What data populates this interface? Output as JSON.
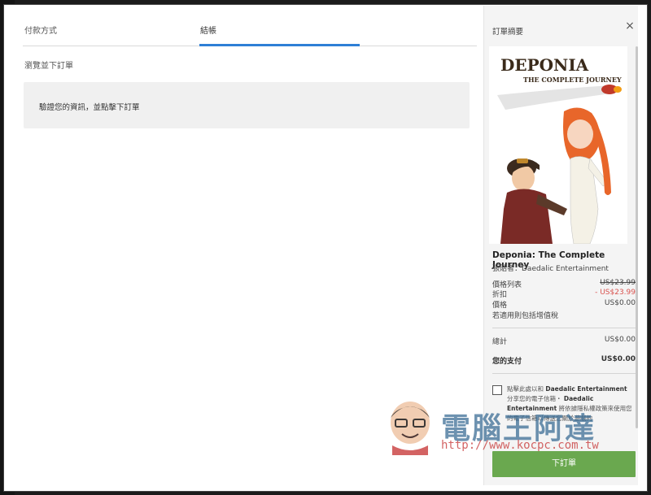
{
  "tabs": {
    "payment": "付款方式",
    "review": "結帳"
  },
  "main": {
    "section_title": "瀏覽並下訂單",
    "info_text": "驗證您的資訊，並點擊下訂單"
  },
  "sidebar": {
    "title": "訂單摘要",
    "close": "×",
    "cover_art": {
      "title_line1": "DEPONIA",
      "title_line2": "THE COMPLETE JOURNEY"
    },
    "product_name": "Deponia: The Complete Journey",
    "publisher": "張貼者：Daedalic Entertainment",
    "list_price": {
      "label": "價格列表",
      "value": "US$23.99"
    },
    "discount": {
      "label": "折扣",
      "value": "- US$23.99"
    },
    "price": {
      "label": "價格",
      "value": "US$0.00"
    },
    "tax_note": "若適用則包括增值稅",
    "subtotal": {
      "label": "總計",
      "value": "US$0.00"
    },
    "you_pay": {
      "label": "您的支付",
      "value": "US$0.00"
    },
    "consent": {
      "part1": "點擊此處以和",
      "company1": "Daedalic Entertainment",
      "part2": "分享您的電子信箱・",
      "company2": "Daedalic Entertainment",
      "part3": "將依據隱私權政策來使用您的電子信箱以傳送您關於遊戲的"
    },
    "order_button": "下訂單"
  },
  "watermark": {
    "text": "電腦王阿達",
    "url": "http://www.kocpc.com.tw"
  },
  "colors": {
    "accent": "#2e7fd6",
    "order_button": "#6aa84f",
    "discount": "#d9534f"
  }
}
